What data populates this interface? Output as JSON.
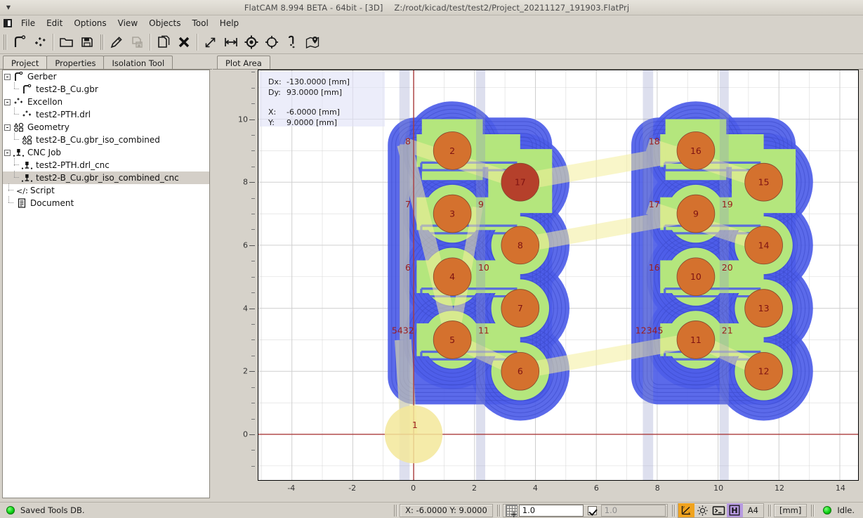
{
  "window": {
    "title": "FlatCAM 8.994 BETA - 64bit - [3D]",
    "project_path": "Z:/root/kicad/test/test2/Project_20211127_191903.FlatPrj",
    "menu_icon": "application-menu-icon"
  },
  "menubar": {
    "items": [
      {
        "label": "File"
      },
      {
        "label": "Edit"
      },
      {
        "label": "Options"
      },
      {
        "label": "View"
      },
      {
        "label": "Objects"
      },
      {
        "label": "Tool"
      },
      {
        "label": "Help"
      }
    ]
  },
  "toolbar": {
    "groups": [
      {
        "buttons": [
          {
            "name": "new-gerber-icon",
            "title": "New Gerber"
          },
          {
            "name": "new-excellon-icon",
            "title": "New Excellon"
          }
        ]
      },
      {
        "buttons": [
          {
            "name": "open-folder-icon",
            "title": "Open Project"
          },
          {
            "name": "save-floppy-icon",
            "title": "Save Project"
          }
        ]
      },
      {
        "buttons": [
          {
            "name": "edit-pencil-icon",
            "title": "Editor"
          },
          {
            "name": "save-object-icon",
            "title": "Save Object"
          }
        ]
      },
      {
        "buttons": [
          {
            "name": "copy-object-icon",
            "title": "Copy Object"
          },
          {
            "name": "delete-cross-icon",
            "title": "Delete Object"
          }
        ]
      },
      {
        "buttons": [
          {
            "name": "distance-diagonal-icon",
            "title": "Distance Tool"
          },
          {
            "name": "distance-min-icon",
            "title": "Distance Min Tool"
          },
          {
            "name": "set-origin-icon",
            "title": "Set Origin"
          },
          {
            "name": "move-to-origin-icon",
            "title": "Move to Origin"
          },
          {
            "name": "jump-to-icon",
            "title": "Jump To"
          },
          {
            "name": "locate-in-object-icon",
            "title": "Locate in Object"
          }
        ]
      }
    ]
  },
  "left_panel": {
    "tabs": [
      {
        "label": "Project",
        "active": true
      },
      {
        "label": "Properties",
        "active": false
      },
      {
        "label": "Isolation Tool",
        "active": false
      }
    ],
    "tree": [
      {
        "label": "Gerber",
        "level": 0,
        "icon": "gerber-icon",
        "expander": "minus",
        "selected": false
      },
      {
        "label": "test2-B_Cu.gbr",
        "level": 1,
        "icon": "gerber-icon",
        "expander": "none",
        "selected": false
      },
      {
        "label": "Excellon",
        "level": 0,
        "icon": "excellon-icon",
        "expander": "minus",
        "selected": false
      },
      {
        "label": "test2-PTH.drl",
        "level": 1,
        "icon": "excellon-icon",
        "expander": "none",
        "selected": false
      },
      {
        "label": "Geometry",
        "level": 0,
        "icon": "geometry-icon",
        "expander": "minus",
        "selected": false
      },
      {
        "label": "test2-B_Cu.gbr_iso_combined",
        "level": 1,
        "icon": "geometry-icon",
        "expander": "none",
        "selected": false
      },
      {
        "label": "CNC Job",
        "level": 0,
        "icon": "cncjob-icon",
        "expander": "minus",
        "selected": false
      },
      {
        "label": "test2-PTH.drl_cnc",
        "level": 1,
        "icon": "cncjob-icon",
        "expander": "none",
        "selected": false
      },
      {
        "label": "test2-B_Cu.gbr_iso_combined_cnc",
        "level": 1,
        "icon": "cncjob-icon",
        "expander": "none",
        "selected": true
      },
      {
        "label": "Script",
        "level": 0,
        "icon": "script-icon",
        "expander": "none",
        "selected": false
      },
      {
        "label": "Document",
        "level": 0,
        "icon": "document-icon",
        "expander": "none",
        "selected": false
      }
    ]
  },
  "plot_panel": {
    "tabs": [
      {
        "label": "Plot Area",
        "active": true
      }
    ],
    "info_overlay": {
      "dx_label": "Dx:",
      "dx_value": "-130.0000 [mm]",
      "dy_label": "Dy:",
      "dy_value": "93.0000 [mm]",
      "x_label": "X:",
      "x_value": "-6.0000 [mm]",
      "y_label": "Y:",
      "y_value": "9.0000 [mm]"
    }
  },
  "chart_data": {
    "type": "scatter",
    "title": "",
    "xlabel": "",
    "ylabel": "",
    "grid": true,
    "legend": "none",
    "xlim": [
      -5.1,
      14.6
    ],
    "ylim": [
      -1.45,
      11.55
    ],
    "xticks": [
      -4,
      -2,
      0,
      2,
      4,
      6,
      8,
      10,
      12,
      14
    ],
    "yticks": [
      0,
      2,
      4,
      6,
      8,
      10
    ],
    "xtick_minor_step": 0.5,
    "ytick_minor_step": 0.5,
    "colors": {
      "pad_orange": "#d4712e",
      "pad_dark_red": "#b5402b",
      "copper_green": "#b4e67d",
      "isolation_blue": "#4d5de8",
      "travel_yellow": "#f4ee9c",
      "axis_red": "#aa3b3b",
      "grid_gray": "#cfcfcf",
      "canvas_bg": "#ffffff",
      "label_red": "#9b1c1c"
    },
    "origin_lines": {
      "x": 0,
      "y": 0
    },
    "pads": [
      {
        "id": "1",
        "x": 0.0,
        "y": 0.0,
        "style": "highlight"
      },
      {
        "id": "2",
        "x": 1.27,
        "y": 9.0,
        "style": "orange"
      },
      {
        "id": "17",
        "x": 3.5,
        "y": 8.0,
        "style": "dark"
      },
      {
        "id": "3",
        "x": 1.27,
        "y": 7.0,
        "style": "orange"
      },
      {
        "id": "8",
        "x": 3.5,
        "y": 6.0,
        "style": "orange"
      },
      {
        "id": "4",
        "x": 1.27,
        "y": 5.0,
        "style": "orange"
      },
      {
        "id": "7",
        "x": 3.5,
        "y": 4.0,
        "style": "orange"
      },
      {
        "id": "5",
        "x": 1.27,
        "y": 3.0,
        "style": "orange"
      },
      {
        "id": "6",
        "x": 3.5,
        "y": 2.0,
        "style": "orange"
      },
      {
        "id": "16",
        "x": 9.27,
        "y": 9.0,
        "style": "orange"
      },
      {
        "id": "15",
        "x": 11.5,
        "y": 8.0,
        "style": "orange"
      },
      {
        "id": "9",
        "x": 9.27,
        "y": 7.0,
        "style": "orange"
      },
      {
        "id": "14",
        "x": 11.5,
        "y": 6.0,
        "style": "orange"
      },
      {
        "id": "10",
        "x": 9.27,
        "y": 5.0,
        "style": "orange"
      },
      {
        "id": "13",
        "x": 11.5,
        "y": 4.0,
        "style": "orange"
      },
      {
        "id": "11",
        "x": 9.27,
        "y": 3.0,
        "style": "orange"
      },
      {
        "id": "12",
        "x": 11.5,
        "y": 2.0,
        "style": "orange"
      }
    ],
    "annotations": [
      {
        "text": "8",
        "x": -0.28,
        "y": 9.2
      },
      {
        "text": "7",
        "x": -0.28,
        "y": 7.2
      },
      {
        "text": "9",
        "x": 2.12,
        "y": 7.2
      },
      {
        "text": "6",
        "x": -0.28,
        "y": 5.2
      },
      {
        "text": "10",
        "x": 2.12,
        "y": 5.2
      },
      {
        "text": "11",
        "x": 2.12,
        "y": 3.2
      },
      {
        "text": "5432",
        "x": -0.72,
        "y": 3.2
      },
      {
        "text": "1",
        "x": -0.05,
        "y": 0.2
      },
      {
        "text": "18",
        "x": 7.72,
        "y": 9.2
      },
      {
        "text": "17",
        "x": 7.72,
        "y": 7.2
      },
      {
        "text": "19",
        "x": 10.12,
        "y": 7.2
      },
      {
        "text": "16",
        "x": 7.72,
        "y": 5.2
      },
      {
        "text": "20",
        "x": 10.12,
        "y": 5.2
      },
      {
        "text": "21",
        "x": 10.12,
        "y": 3.2
      },
      {
        "text": "12345",
        "x": 7.28,
        "y": 3.2
      }
    ]
  },
  "statusbar": {
    "status_led": "status-led-green",
    "status_message": "Saved Tools DB.",
    "coords": "X: -6.0000   Y: 9.0000",
    "grid_icon": "snap-grid-icon",
    "grid_x_value": "1.0",
    "grid_link_checked": true,
    "grid_y_value": "1.0",
    "axis_toggle_icon": "axis-icon",
    "settings_icon": "gear-icon",
    "shell_icon": "terminal-icon",
    "hud_icon": "hud-H-icon",
    "paper_size": "A4",
    "units": "[mm]",
    "activity_led": "activity-led-green",
    "activity_text": "Idle."
  }
}
